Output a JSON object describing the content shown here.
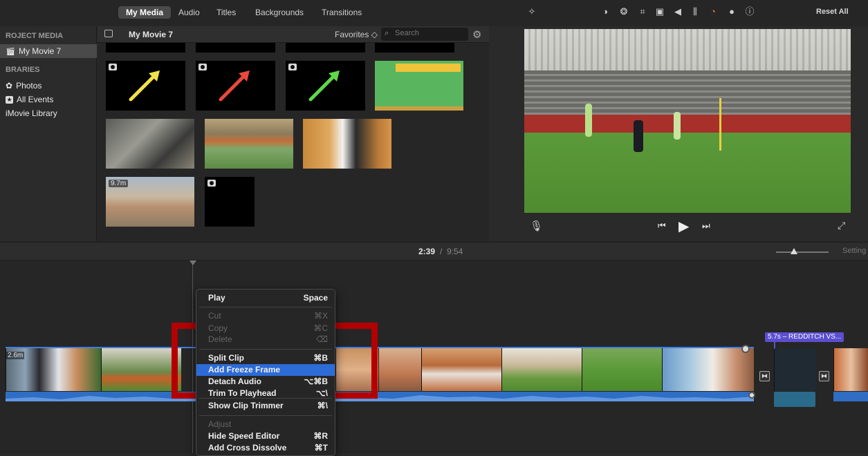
{
  "toolbar": {
    "tabs": [
      "My Media",
      "Audio",
      "Titles",
      "Backgrounds",
      "Transitions"
    ],
    "reset_all": "Reset All"
  },
  "sidebar": {
    "project_media_heading": "ROJECT MEDIA",
    "project": "My Movie 7",
    "libraries_heading": "BRARIES",
    "items": [
      "Photos",
      "All Events",
      "iMovie Library"
    ]
  },
  "browser": {
    "title": "My Movie 7",
    "filter": "Favorites",
    "search_placeholder": "Search",
    "clip_badge": "9.7m"
  },
  "timeline": {
    "current_time": "2:39",
    "total_time": "9:54",
    "settings_label": "Setting",
    "first_clip_badge": "2.6m",
    "title_clip": "5.7s – REDDITCH VS..."
  },
  "context_menu": {
    "items": [
      {
        "label": "Play",
        "shortcut": "Space",
        "state": "enabled"
      },
      {
        "label": "Cut",
        "shortcut": "⌘X",
        "state": "disabled"
      },
      {
        "label": "Copy",
        "shortcut": "⌘C",
        "state": "disabled"
      },
      {
        "label": "Delete",
        "shortcut": "⌫",
        "state": "disabled"
      },
      {
        "label": "Split Clip",
        "shortcut": "⌘B",
        "state": "enabled"
      },
      {
        "label": "Add Freeze Frame",
        "shortcut": "",
        "state": "highlighted"
      },
      {
        "label": "Detach Audio",
        "shortcut": "⌥⌘B",
        "state": "enabled"
      },
      {
        "label": "Trim To Playhead",
        "shortcut": "⌥\\",
        "state": "enabled"
      },
      {
        "label": "Show Clip Trimmer",
        "shortcut": "⌘\\",
        "state": "enabled"
      },
      {
        "label": "Adjust",
        "shortcut": "",
        "state": "disabled"
      },
      {
        "label": "Hide Speed Editor",
        "shortcut": "⌘R",
        "state": "enabled"
      },
      {
        "label": "Add Cross Dissolve",
        "shortcut": "⌘T",
        "state": "enabled"
      }
    ]
  },
  "colors": {
    "accent": "#2d6bd6",
    "highlight_box": "#b40000",
    "audio_wave": "#2f6ec4",
    "title_clip": "#5b4fd0",
    "timer_icon": "#e07b2a"
  }
}
